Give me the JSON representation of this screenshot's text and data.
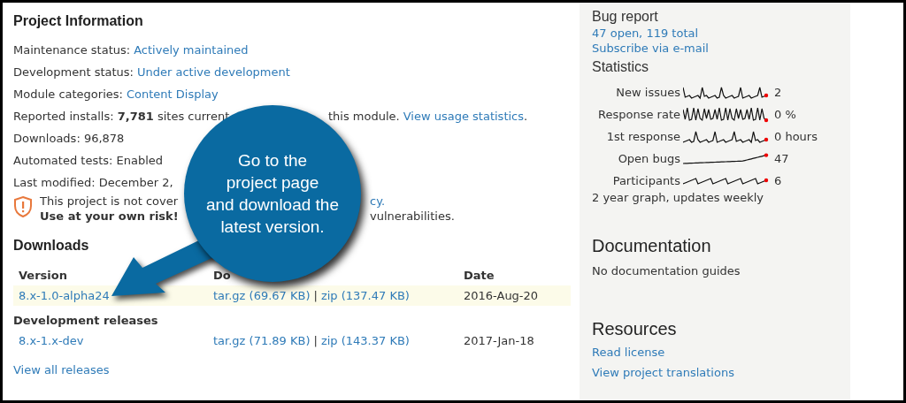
{
  "project_information": {
    "title": "Project Information",
    "lines": [
      {
        "kind": "field",
        "label": "Maintenance status:",
        "link": "Actively maintained"
      },
      {
        "kind": "field",
        "label": "Development status:",
        "link": "Under active development"
      },
      {
        "kind": "field",
        "label": "Module categories:",
        "link": "Content Display"
      },
      {
        "kind": "split",
        "left": "Reported installs: **7,781** sites current",
        "right": "this module.",
        "link": "View usage statistics",
        "tail": "."
      },
      {
        "kind": "plain",
        "text": "Downloads: 96,878"
      },
      {
        "kind": "plain",
        "text": "Automated tests: Enabled"
      },
      {
        "kind": "plain",
        "text": "Last modified: December 2,"
      }
    ],
    "warning": {
      "lines": [
        {
          "left": "This project is not cover",
          "right_link": "cy."
        },
        {
          "left": "**Use at your own risk!**",
          "right": "vulnerabilities."
        }
      ]
    }
  },
  "downloads": {
    "title": "Downloads",
    "columns": [
      "Version",
      "Do",
      "Date"
    ],
    "rows": [
      {
        "version": "8.x-1.0-alpha24",
        "files": [
          "tar.gz (69.67 KB)",
          "zip (137.47 KB)"
        ],
        "separator": "|",
        "date": "2016-Aug-20",
        "highlighted": true
      }
    ],
    "development": {
      "title": "Development releases",
      "rows": [
        {
          "version": "8.x-1.x-dev",
          "files": [
            "tar.gz (71.89 KB)",
            "zip (143.37 KB)"
          ],
          "separator": "|",
          "date": "2017-Jan-18",
          "highlighted": false
        }
      ]
    },
    "view_all": "View all releases"
  },
  "callout": {
    "text": "Go to the\nproject page\nand download the\nlatest version."
  },
  "sidebar": {
    "bug_report": {
      "title": "Bug report",
      "links": [
        "47 open, 119 total",
        "Subscribe via e-mail"
      ]
    },
    "statistics": {
      "title": "Statistics",
      "rows": [
        {
          "label": "New issues",
          "value": "2",
          "kind": "spiky"
        },
        {
          "label": "Response rate",
          "value": "0 %",
          "kind": "square"
        },
        {
          "label": "1st response",
          "value": "0 hours",
          "kind": "spiky"
        },
        {
          "label": "Open bugs",
          "value": "47",
          "kind": "rising"
        },
        {
          "label": "Participants",
          "value": "6",
          "kind": "noisy"
        }
      ],
      "note": "2 year graph, updates weekly"
    },
    "documentation": {
      "title": "Documentation",
      "text": "No documentation guides"
    },
    "resources": {
      "title": "Resources",
      "links": [
        "Read license",
        "View project translations"
      ]
    }
  }
}
